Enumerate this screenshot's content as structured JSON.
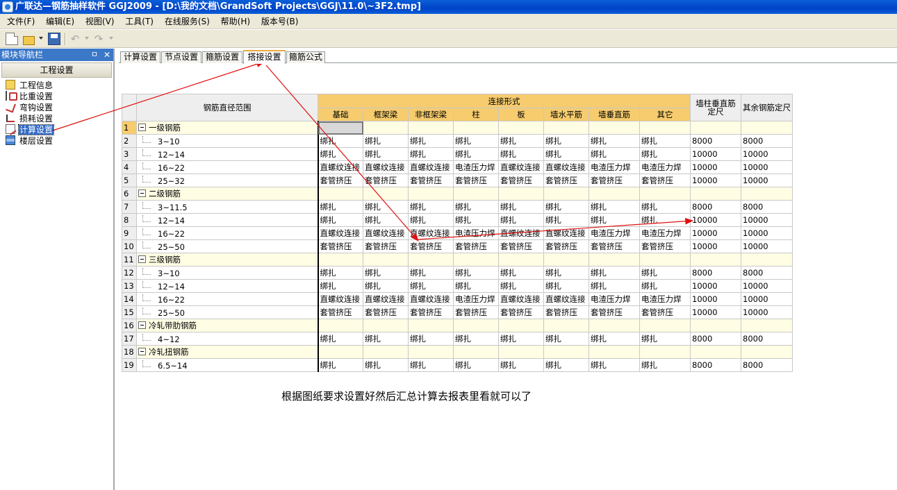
{
  "window": {
    "title": "广联达—钢筋抽样软件 GGJ2009 - [D:\\我的文档\\GrandSoft Projects\\GGJ\\11.0\\~3F2.tmp]"
  },
  "menu": [
    "文件(F)",
    "编辑(E)",
    "视图(V)",
    "工具(T)",
    "在线服务(S)",
    "帮助(H)",
    "版本号(B)"
  ],
  "toolbar": {
    "icons": [
      "new-icon",
      "open-icon",
      "save-icon",
      "undo-icon",
      "redo-icon"
    ]
  },
  "nav": {
    "title": "模块导航栏",
    "pin": "ㅁ",
    "close": "✕",
    "section": "工程设置",
    "items": [
      {
        "label": "工程信息",
        "icon": "project-info-icon"
      },
      {
        "label": "比重设置",
        "icon": "weight-icon"
      },
      {
        "label": "弯钩设置",
        "icon": "hook-icon"
      },
      {
        "label": "损耗设置",
        "icon": "loss-icon"
      },
      {
        "label": "计算设置",
        "icon": "calc-settings-icon",
        "selected": true
      },
      {
        "label": "楼层设置",
        "icon": "floor-icon"
      }
    ]
  },
  "tabs": [
    "计算设置",
    "节点设置",
    "箍筋设置",
    "搭接设置",
    "箍筋公式"
  ],
  "active_tab": "搭接设置",
  "grid": {
    "range_header": "钢筋直径范围",
    "group_header": "连接形式",
    "sub_headers": [
      "基础",
      "框架梁",
      "非框架梁",
      "柱",
      "板",
      "墙水平筋",
      "墙垂直筋",
      "其它"
    ],
    "extra_headers": [
      "墙柱垂直筋定尺",
      "其余钢筋定尺"
    ],
    "rows": [
      {
        "num": "1",
        "name": "一级钢筋",
        "group": true
      },
      {
        "num": "2",
        "name": "3~10",
        "cells": [
          "绑扎",
          "绑扎",
          "绑扎",
          "绑扎",
          "绑扎",
          "绑扎",
          "绑扎",
          "绑扎",
          "8000",
          "8000"
        ]
      },
      {
        "num": "3",
        "name": "12~14",
        "cells": [
          "绑扎",
          "绑扎",
          "绑扎",
          "绑扎",
          "绑扎",
          "绑扎",
          "绑扎",
          "绑扎",
          "10000",
          "10000"
        ]
      },
      {
        "num": "4",
        "name": "16~22",
        "cells": [
          "直螺纹连接",
          "直螺纹连接",
          "直螺纹连接",
          "电渣压力焊",
          "直螺纹连接",
          "直螺纹连接",
          "电渣压力焊",
          "电渣压力焊",
          "10000",
          "10000"
        ]
      },
      {
        "num": "5",
        "name": "25~32",
        "cells": [
          "套管挤压",
          "套管挤压",
          "套管挤压",
          "套管挤压",
          "套管挤压",
          "套管挤压",
          "套管挤压",
          "套管挤压",
          "10000",
          "10000"
        ]
      },
      {
        "num": "6",
        "name": "二级钢筋",
        "group": true
      },
      {
        "num": "7",
        "name": "3~11.5",
        "cells": [
          "绑扎",
          "绑扎",
          "绑扎",
          "绑扎",
          "绑扎",
          "绑扎",
          "绑扎",
          "绑扎",
          "8000",
          "8000"
        ]
      },
      {
        "num": "8",
        "name": "12~14",
        "cells": [
          "绑扎",
          "绑扎",
          "绑扎",
          "绑扎",
          "绑扎",
          "绑扎",
          "绑扎",
          "绑扎",
          "10000",
          "10000"
        ]
      },
      {
        "num": "9",
        "name": "16~22",
        "cells": [
          "直螺纹连接",
          "直螺纹连接",
          "直螺纹连接",
          "电渣压力焊",
          "直螺纹连接",
          "直螺纹连接",
          "电渣压力焊",
          "电渣压力焊",
          "10000",
          "10000"
        ]
      },
      {
        "num": "10",
        "name": "25~50",
        "cells": [
          "套管挤压",
          "套管挤压",
          "套管挤压",
          "套管挤压",
          "套管挤压",
          "套管挤压",
          "套管挤压",
          "套管挤压",
          "10000",
          "10000"
        ]
      },
      {
        "num": "11",
        "name": "三级钢筋",
        "group": true
      },
      {
        "num": "12",
        "name": "3~10",
        "cells": [
          "绑扎",
          "绑扎",
          "绑扎",
          "绑扎",
          "绑扎",
          "绑扎",
          "绑扎",
          "绑扎",
          "8000",
          "8000"
        ]
      },
      {
        "num": "13",
        "name": "12~14",
        "cells": [
          "绑扎",
          "绑扎",
          "绑扎",
          "绑扎",
          "绑扎",
          "绑扎",
          "绑扎",
          "绑扎",
          "10000",
          "10000"
        ]
      },
      {
        "num": "14",
        "name": "16~22",
        "cells": [
          "直螺纹连接",
          "直螺纹连接",
          "直螺纹连接",
          "电渣压力焊",
          "直螺纹连接",
          "直螺纹连接",
          "电渣压力焊",
          "电渣压力焊",
          "10000",
          "10000"
        ]
      },
      {
        "num": "15",
        "name": "25~50",
        "cells": [
          "套管挤压",
          "套管挤压",
          "套管挤压",
          "套管挤压",
          "套管挤压",
          "套管挤压",
          "套管挤压",
          "套管挤压",
          "10000",
          "10000"
        ]
      },
      {
        "num": "16",
        "name": "冷轧带肋钢筋",
        "group": true
      },
      {
        "num": "17",
        "name": "4~12",
        "cells": [
          "绑扎",
          "绑扎",
          "绑扎",
          "绑扎",
          "绑扎",
          "绑扎",
          "绑扎",
          "绑扎",
          "8000",
          "8000"
        ]
      },
      {
        "num": "18",
        "name": "冷轧扭钢筋",
        "group": true
      },
      {
        "num": "19",
        "name": "6.5~14",
        "cells": [
          "绑扎",
          "绑扎",
          "绑扎",
          "绑扎",
          "绑扎",
          "绑扎",
          "绑扎",
          "绑扎",
          "8000",
          "8000"
        ]
      }
    ]
  },
  "note": "根据图纸要求设置好然后汇总计算去报表里看就可以了",
  "colors": {
    "titlebar": "#0a5fd8",
    "header_orange": "#f6cc6e",
    "group_row": "#fffde4",
    "annotation": "#e01010",
    "selection": "#316ac5"
  }
}
